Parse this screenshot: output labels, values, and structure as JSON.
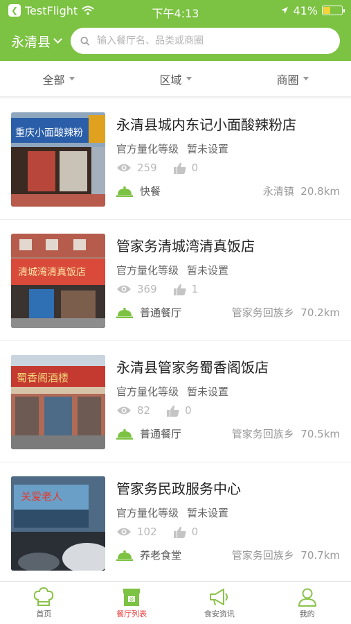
{
  "status_bar": {
    "back_app": "TestFlight",
    "time": "下午4:13",
    "battery": "41%",
    "battery_level": 0.41
  },
  "header": {
    "city": "永清县",
    "search_placeholder": "输入餐厅名、品类或商圈"
  },
  "filters": [
    {
      "label": "全部"
    },
    {
      "label": "区域"
    },
    {
      "label": "商圈"
    }
  ],
  "restaurants": [
    {
      "name": "永清县城内东记小面酸辣粉店",
      "grade_label": "官方量化等级",
      "grade_value": "暂未设置",
      "views": "259",
      "likes": "0",
      "category": "快餐",
      "area": "永清镇",
      "distance": "20.8km",
      "sign_text": "重庆小面酸辣粉"
    },
    {
      "name": "管家务清城湾清真饭店",
      "grade_label": "官方量化等级",
      "grade_value": "暂未设置",
      "views": "369",
      "likes": "1",
      "category": "普通餐厅",
      "area": "管家务回族乡",
      "distance": "70.2km",
      "sign_text": "清城湾清真饭店"
    },
    {
      "name": "永清县管家务蜀香阁饭店",
      "grade_label": "官方量化等级",
      "grade_value": "暂未设置",
      "views": "82",
      "likes": "0",
      "category": "普通餐厅",
      "area": "管家务回族乡",
      "distance": "70.5km",
      "sign_text": "蜀香阁酒楼"
    },
    {
      "name": "管家务民政服务中心",
      "grade_label": "官方量化等级",
      "grade_value": "暂未设置",
      "views": "102",
      "likes": "0",
      "category": "养老食堂",
      "area": "管家务回族乡",
      "distance": "70.7km",
      "sign_text": "关爱老人"
    }
  ],
  "tabs": [
    {
      "label": "首页"
    },
    {
      "label": "餐厅列表"
    },
    {
      "label": "食安资讯"
    },
    {
      "label": "我的"
    }
  ],
  "colors": {
    "brand_green": "#7cc243",
    "active_red": "#e8403d"
  }
}
